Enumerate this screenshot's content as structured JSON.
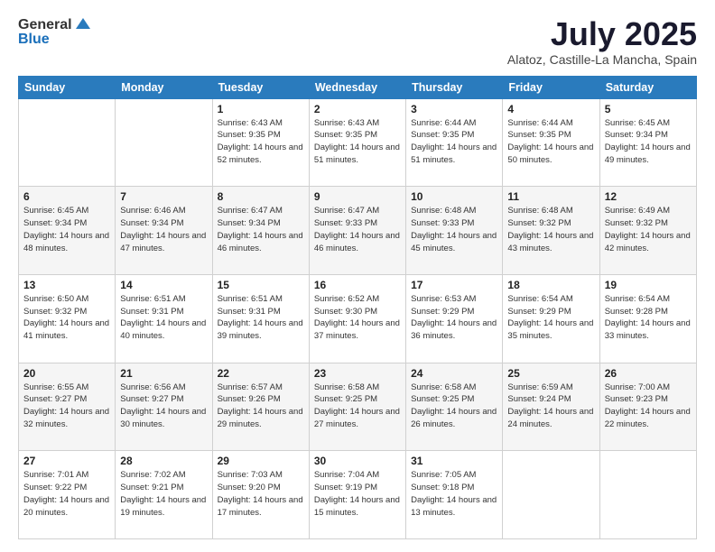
{
  "logo": {
    "general": "General",
    "blue": "Blue"
  },
  "title": {
    "month": "July 2025",
    "location": "Alatoz, Castille-La Mancha, Spain"
  },
  "weekdays": [
    "Sunday",
    "Monday",
    "Tuesday",
    "Wednesday",
    "Thursday",
    "Friday",
    "Saturday"
  ],
  "weeks": [
    [
      {
        "day": "",
        "sunrise": "",
        "sunset": "",
        "daylight": ""
      },
      {
        "day": "",
        "sunrise": "",
        "sunset": "",
        "daylight": ""
      },
      {
        "day": "1",
        "sunrise": "Sunrise: 6:43 AM",
        "sunset": "Sunset: 9:35 PM",
        "daylight": "Daylight: 14 hours and 52 minutes."
      },
      {
        "day": "2",
        "sunrise": "Sunrise: 6:43 AM",
        "sunset": "Sunset: 9:35 PM",
        "daylight": "Daylight: 14 hours and 51 minutes."
      },
      {
        "day": "3",
        "sunrise": "Sunrise: 6:44 AM",
        "sunset": "Sunset: 9:35 PM",
        "daylight": "Daylight: 14 hours and 51 minutes."
      },
      {
        "day": "4",
        "sunrise": "Sunrise: 6:44 AM",
        "sunset": "Sunset: 9:35 PM",
        "daylight": "Daylight: 14 hours and 50 minutes."
      },
      {
        "day": "5",
        "sunrise": "Sunrise: 6:45 AM",
        "sunset": "Sunset: 9:34 PM",
        "daylight": "Daylight: 14 hours and 49 minutes."
      }
    ],
    [
      {
        "day": "6",
        "sunrise": "Sunrise: 6:45 AM",
        "sunset": "Sunset: 9:34 PM",
        "daylight": "Daylight: 14 hours and 48 minutes."
      },
      {
        "day": "7",
        "sunrise": "Sunrise: 6:46 AM",
        "sunset": "Sunset: 9:34 PM",
        "daylight": "Daylight: 14 hours and 47 minutes."
      },
      {
        "day": "8",
        "sunrise": "Sunrise: 6:47 AM",
        "sunset": "Sunset: 9:34 PM",
        "daylight": "Daylight: 14 hours and 46 minutes."
      },
      {
        "day": "9",
        "sunrise": "Sunrise: 6:47 AM",
        "sunset": "Sunset: 9:33 PM",
        "daylight": "Daylight: 14 hours and 46 minutes."
      },
      {
        "day": "10",
        "sunrise": "Sunrise: 6:48 AM",
        "sunset": "Sunset: 9:33 PM",
        "daylight": "Daylight: 14 hours and 45 minutes."
      },
      {
        "day": "11",
        "sunrise": "Sunrise: 6:48 AM",
        "sunset": "Sunset: 9:32 PM",
        "daylight": "Daylight: 14 hours and 43 minutes."
      },
      {
        "day": "12",
        "sunrise": "Sunrise: 6:49 AM",
        "sunset": "Sunset: 9:32 PM",
        "daylight": "Daylight: 14 hours and 42 minutes."
      }
    ],
    [
      {
        "day": "13",
        "sunrise": "Sunrise: 6:50 AM",
        "sunset": "Sunset: 9:32 PM",
        "daylight": "Daylight: 14 hours and 41 minutes."
      },
      {
        "day": "14",
        "sunrise": "Sunrise: 6:51 AM",
        "sunset": "Sunset: 9:31 PM",
        "daylight": "Daylight: 14 hours and 40 minutes."
      },
      {
        "day": "15",
        "sunrise": "Sunrise: 6:51 AM",
        "sunset": "Sunset: 9:31 PM",
        "daylight": "Daylight: 14 hours and 39 minutes."
      },
      {
        "day": "16",
        "sunrise": "Sunrise: 6:52 AM",
        "sunset": "Sunset: 9:30 PM",
        "daylight": "Daylight: 14 hours and 37 minutes."
      },
      {
        "day": "17",
        "sunrise": "Sunrise: 6:53 AM",
        "sunset": "Sunset: 9:29 PM",
        "daylight": "Daylight: 14 hours and 36 minutes."
      },
      {
        "day": "18",
        "sunrise": "Sunrise: 6:54 AM",
        "sunset": "Sunset: 9:29 PM",
        "daylight": "Daylight: 14 hours and 35 minutes."
      },
      {
        "day": "19",
        "sunrise": "Sunrise: 6:54 AM",
        "sunset": "Sunset: 9:28 PM",
        "daylight": "Daylight: 14 hours and 33 minutes."
      }
    ],
    [
      {
        "day": "20",
        "sunrise": "Sunrise: 6:55 AM",
        "sunset": "Sunset: 9:27 PM",
        "daylight": "Daylight: 14 hours and 32 minutes."
      },
      {
        "day": "21",
        "sunrise": "Sunrise: 6:56 AM",
        "sunset": "Sunset: 9:27 PM",
        "daylight": "Daylight: 14 hours and 30 minutes."
      },
      {
        "day": "22",
        "sunrise": "Sunrise: 6:57 AM",
        "sunset": "Sunset: 9:26 PM",
        "daylight": "Daylight: 14 hours and 29 minutes."
      },
      {
        "day": "23",
        "sunrise": "Sunrise: 6:58 AM",
        "sunset": "Sunset: 9:25 PM",
        "daylight": "Daylight: 14 hours and 27 minutes."
      },
      {
        "day": "24",
        "sunrise": "Sunrise: 6:58 AM",
        "sunset": "Sunset: 9:25 PM",
        "daylight": "Daylight: 14 hours and 26 minutes."
      },
      {
        "day": "25",
        "sunrise": "Sunrise: 6:59 AM",
        "sunset": "Sunset: 9:24 PM",
        "daylight": "Daylight: 14 hours and 24 minutes."
      },
      {
        "day": "26",
        "sunrise": "Sunrise: 7:00 AM",
        "sunset": "Sunset: 9:23 PM",
        "daylight": "Daylight: 14 hours and 22 minutes."
      }
    ],
    [
      {
        "day": "27",
        "sunrise": "Sunrise: 7:01 AM",
        "sunset": "Sunset: 9:22 PM",
        "daylight": "Daylight: 14 hours and 20 minutes."
      },
      {
        "day": "28",
        "sunrise": "Sunrise: 7:02 AM",
        "sunset": "Sunset: 9:21 PM",
        "daylight": "Daylight: 14 hours and 19 minutes."
      },
      {
        "day": "29",
        "sunrise": "Sunrise: 7:03 AM",
        "sunset": "Sunset: 9:20 PM",
        "daylight": "Daylight: 14 hours and 17 minutes."
      },
      {
        "day": "30",
        "sunrise": "Sunrise: 7:04 AM",
        "sunset": "Sunset: 9:19 PM",
        "daylight": "Daylight: 14 hours and 15 minutes."
      },
      {
        "day": "31",
        "sunrise": "Sunrise: 7:05 AM",
        "sunset": "Sunset: 9:18 PM",
        "daylight": "Daylight: 14 hours and 13 minutes."
      },
      {
        "day": "",
        "sunrise": "",
        "sunset": "",
        "daylight": ""
      },
      {
        "day": "",
        "sunrise": "",
        "sunset": "",
        "daylight": ""
      }
    ]
  ]
}
